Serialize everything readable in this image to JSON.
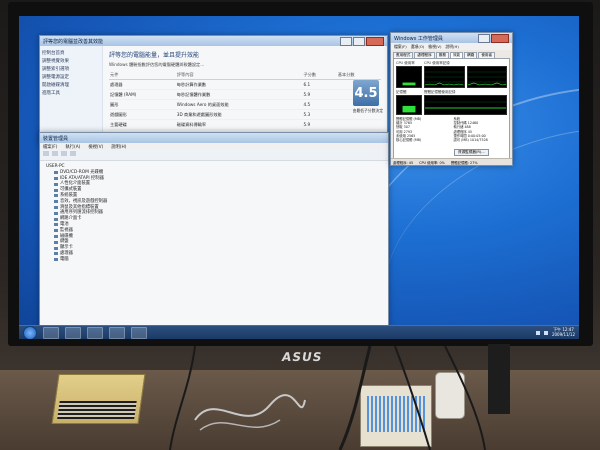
{
  "scene": {
    "monitor_brand": "ASUS"
  },
  "windows": {
    "wei": {
      "title": "評等您的電腦並改善其效能",
      "heading": "評等您的電腦能量，並且提升效能",
      "subtext": "Windows 體驗指數評估您的電腦硬體與軟體設定...",
      "sidebar": [
        "控制台首頁",
        "調整視覺效果",
        "調整索引選項",
        "調整電源設定",
        "開啟磁碟清理",
        "進階工具"
      ],
      "columns": [
        "元件",
        "評等內容",
        "子分數",
        "基本分數"
      ],
      "rows": [
        {
          "component": "處理器",
          "detail": "每秒計算作業數",
          "score": "6.1"
        },
        {
          "component": "記憶體 (RAM)",
          "detail": "每秒記憶體作業數",
          "score": "5.9"
        },
        {
          "component": "圖形",
          "detail": "Windows Aero 的桌面效能",
          "score": "4.5"
        },
        {
          "component": "遊戲圖形",
          "detail": "3D 商業和遊戲圖形效能",
          "score": "5.3"
        },
        {
          "component": "主要硬碟",
          "detail": "磁碟資料傳輸率",
          "score": "5.9"
        }
      ],
      "base_score": "4.5",
      "score_caption": "由最低子分數決定"
    },
    "devmgr": {
      "title": "裝置管理員",
      "menu": [
        "檔案(F)",
        "執行(A)",
        "檢視(V)",
        "說明(H)"
      ],
      "root": "USER-PC",
      "nodes": [
        "DVD/CD-ROM 光碟機",
        "IDE ATA/ATAPI 控制器",
        "人性化介面裝置",
        "可攜式裝置",
        "系統裝置",
        "音效，視訊及遊戲控制器",
        "滑鼠及其他指標裝置",
        "通用序列匯流排控制器",
        "網路介面卡",
        "電池",
        "監視器",
        "磁碟機",
        "鍵盤",
        "顯示卡",
        "處理器",
        "電腦"
      ]
    },
    "taskmgr": {
      "title": "Windows 工作管理員",
      "menu": [
        "檔案(F)",
        "選項(O)",
        "檢視(V)",
        "說明(H)"
      ],
      "tabs": [
        "應用程式",
        "處理程序",
        "服務",
        "效能",
        "網路",
        "使用者"
      ],
      "active_tab": "效能",
      "labels": {
        "cpu": "CPU 使用率",
        "cpu_history": "CPU 使用率記錄",
        "mem": "記憶體",
        "mem_history": "實體記憶體使用記錄"
      },
      "stats": [
        {
          "label": "實體記憶體 (MB)",
          "value": ""
        },
        {
          "label": "系統",
          "value": ""
        },
        {
          "label": "總計",
          "value": "3765"
        },
        {
          "label": "控制代碼",
          "value": "12460"
        },
        {
          "label": "快取",
          "value": "307"
        },
        {
          "label": "執行緒",
          "value": "488"
        },
        {
          "label": "可用",
          "value": "2793"
        },
        {
          "label": "處理程序",
          "value": "45"
        },
        {
          "label": "未使用",
          "value": "2565"
        },
        {
          "label": "運作時間",
          "value": "0:00:05:00"
        },
        {
          "label": "核心記憶體 (MB)",
          "value": ""
        },
        {
          "label": "認可 (MB)",
          "value": "1014/7528"
        }
      ],
      "resource_button": "資源監視器(R)...",
      "status": {
        "processes": "處理程序: 45",
        "cpu": "CPU 使用率: 0%",
        "memory": "實體記憶體: 27%"
      }
    }
  },
  "taskbar": {
    "clock_time": "下午 12:47",
    "clock_date": "2009/11/12"
  }
}
